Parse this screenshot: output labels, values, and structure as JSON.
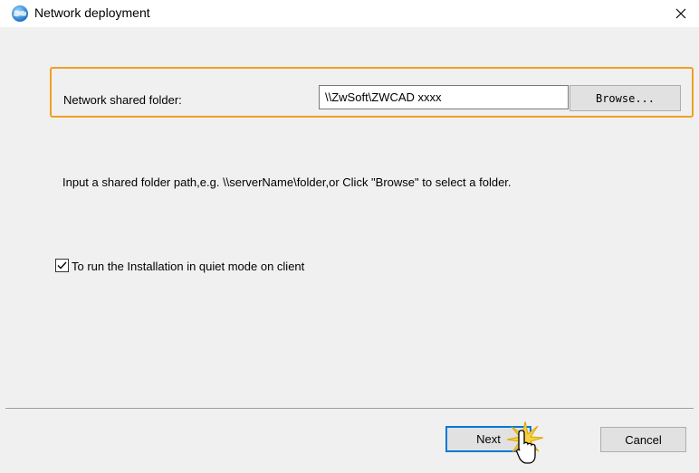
{
  "window": {
    "title": "Network deployment",
    "icon": "globe-icon",
    "close_icon": "close-icon"
  },
  "form": {
    "folder_label": "Network shared folder:",
    "folder_value": "\\\\ZwSoft\\ZWCAD xxxx",
    "browse_label": "Browse...",
    "hint": "Input a shared folder path,e.g. \\\\serverName\\folder,or Click \"Browse\" to select a folder.",
    "quiet_mode_label": "To run the Installation in quiet mode on client",
    "quiet_mode_checked": true
  },
  "footer": {
    "next_label": "Next",
    "cancel_label": "Cancel"
  },
  "colors": {
    "highlight": "#f0a020",
    "focus": "#0078d7",
    "dialog_bg": "#f0f0f0",
    "button_bg": "#e1e1e1"
  }
}
